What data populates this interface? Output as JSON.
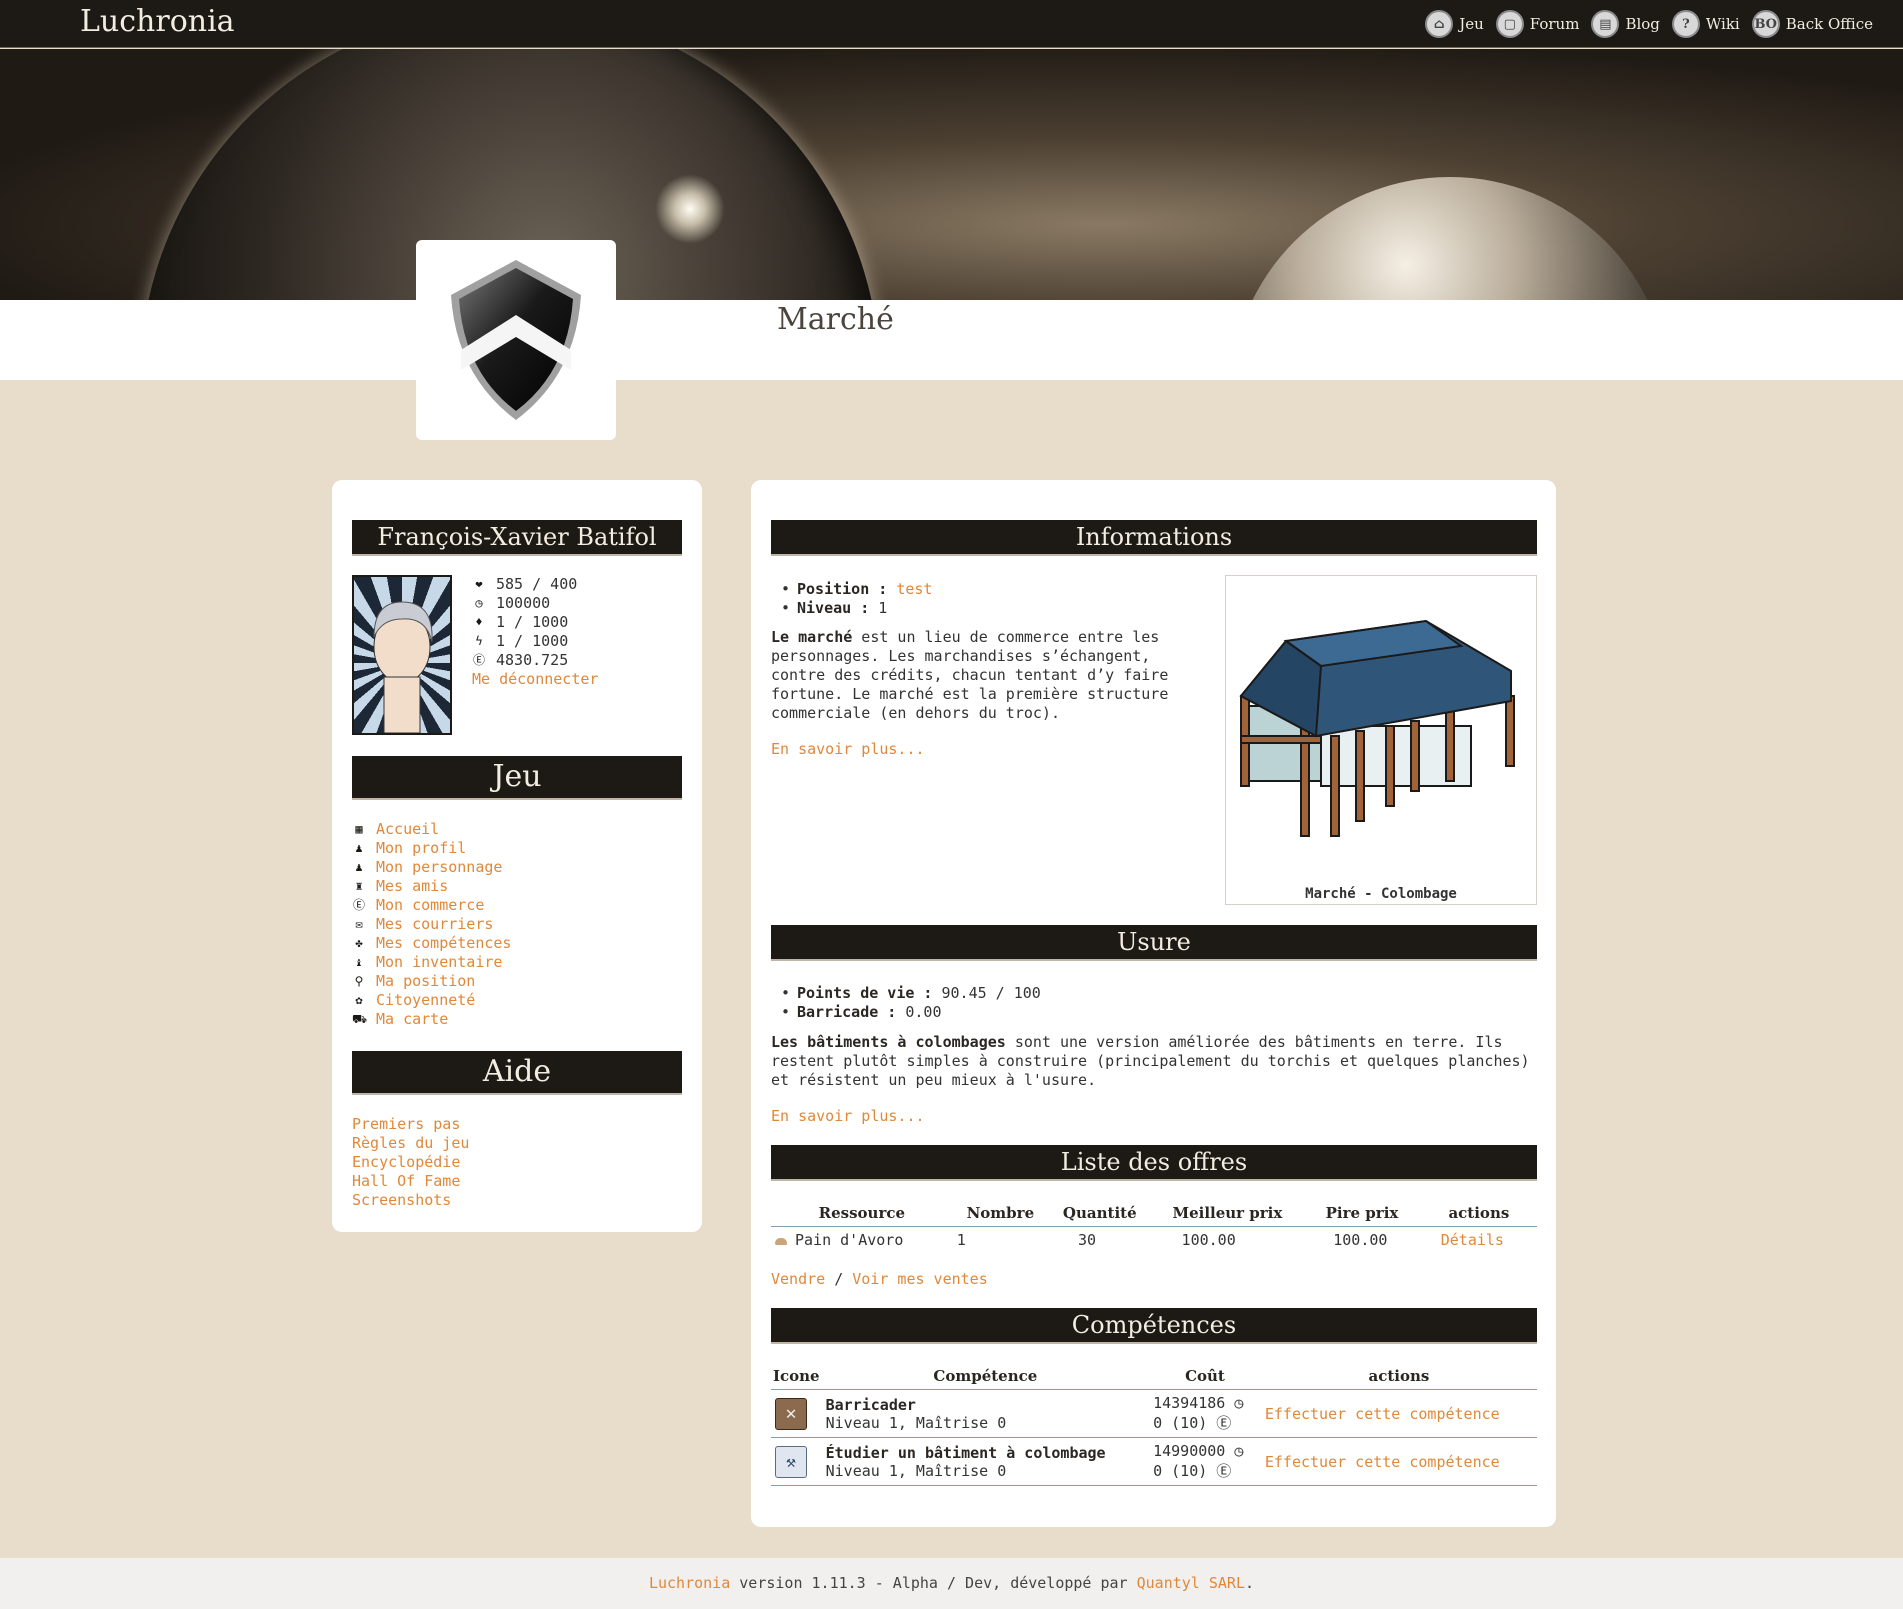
{
  "app": {
    "brand": "Luchronia"
  },
  "nav": [
    {
      "label": "Jeu",
      "icon": "home-icon",
      "glyph": "⌂"
    },
    {
      "label": "Forum",
      "icon": "forum-icon",
      "glyph": "💬"
    },
    {
      "label": "Blog",
      "icon": "blog-icon",
      "glyph": "▤"
    },
    {
      "label": "Wiki",
      "icon": "wiki-icon",
      "glyph": "?"
    },
    {
      "label": "Back Office",
      "icon": "back-office-icon",
      "glyph": "BO"
    }
  ],
  "page": {
    "title": "Marché"
  },
  "character": {
    "name": "François-Xavier Batifol",
    "stats": [
      {
        "icon": "heart-icon",
        "glyph": "❤",
        "value": "585 / 400"
      },
      {
        "icon": "clock-icon",
        "glyph": "◷",
        "value": "100000"
      },
      {
        "icon": "drop-icon",
        "glyph": "💧",
        "value": "1 / 1000"
      },
      {
        "icon": "lightning-icon",
        "glyph": "⚡",
        "value": "1 / 1000"
      },
      {
        "icon": "credits-icon",
        "glyph": "Ⓔ",
        "value": "4830.725"
      }
    ],
    "logout": "Me déconnecter"
  },
  "jeu": {
    "title": "Jeu",
    "items": [
      {
        "label": "Accueil",
        "icon": "home-icon",
        "glyph": "▦"
      },
      {
        "label": "Mon profil",
        "icon": "profile-icon",
        "glyph": "♟"
      },
      {
        "label": "Mon personnage",
        "icon": "character-icon",
        "glyph": "♟"
      },
      {
        "label": "Mes amis",
        "icon": "friends-icon",
        "glyph": "♜"
      },
      {
        "label": "Mon commerce",
        "icon": "commerce-icon",
        "glyph": "Ⓔ"
      },
      {
        "label": "Mes courriers",
        "icon": "mail-icon",
        "glyph": "✉"
      },
      {
        "label": "Mes compétences",
        "icon": "skills-icon",
        "glyph": "✤"
      },
      {
        "label": "Mon inventaire",
        "icon": "inventory-icon",
        "glyph": "♝"
      },
      {
        "label": "Ma position",
        "icon": "location-icon",
        "glyph": "⚲"
      },
      {
        "label": "Citoyenneté",
        "icon": "citizenship-icon",
        "glyph": "✿"
      },
      {
        "label": "Ma carte",
        "icon": "map-icon",
        "glyph": "⛟"
      }
    ]
  },
  "aide": {
    "title": "Aide",
    "items": [
      "Premiers pas",
      "Règles du jeu",
      "Encyclopédie",
      "Hall Of Fame",
      "Screenshots"
    ]
  },
  "informations": {
    "title": "Informations",
    "position_label": "Position",
    "position_value": "test",
    "niveau_label": "Niveau",
    "niveau_value": "1",
    "desc_bold": "Le marché",
    "desc_rest": " est un lieu de commerce entre les personnages. Les marchandises s’échangent, contre des crédits, chacun tentant d’y faire fortune. Le marché est la première structure commerciale (en dehors du troc).",
    "more": "En savoir plus...",
    "image_caption": "Marché - Colombage"
  },
  "usure": {
    "title": "Usure",
    "pv_label": "Points de vie",
    "pv_value": "90.45 / 100",
    "barricade_label": "Barricade",
    "barricade_value": "0.00",
    "desc_bold": "Les bâtiments à colombages",
    "desc_rest": " sont une version améliorée des bâtiments en terre. Ils restent plutôt simples à construire (principalement du torchis et quelques planches) et résistent un peu mieux à l'usure.",
    "more": "En savoir plus..."
  },
  "offres": {
    "title": "Liste des offres",
    "columns": [
      "Ressource",
      "Nombre",
      "Quantité",
      "Meilleur prix",
      "Pire prix",
      "actions"
    ],
    "rows": [
      {
        "resource": "Pain d'Avoro",
        "nombre": "1",
        "quantite": "30",
        "meilleur": "100.00",
        "pire": "100.00",
        "action": "Détails"
      }
    ],
    "vendre": "Vendre",
    "sep": " / ",
    "mes_ventes": "Voir mes ventes"
  },
  "competences": {
    "title": "Compétences",
    "columns": [
      "Icone",
      "Compétence",
      "Coût",
      "actions"
    ],
    "rows": [
      {
        "icon": "barricade-icon",
        "name": "Barricader",
        "sub": "Niveau 1, Maîtrise 0",
        "time": "14394186",
        "credits": "0 (10)",
        "action": "Effectuer cette compétence"
      },
      {
        "icon": "study-building-icon",
        "name": "Étudier un bâtiment à colombage",
        "sub": "Niveau 1, Maîtrise 0",
        "time": "14990000",
        "credits": "0 (10)",
        "action": "Effectuer cette compétence"
      }
    ]
  },
  "footer": {
    "brand": "Luchronia",
    "text": " version 1.11.3 - Alpha / Dev, développé par ",
    "company": "Quantyl SARL",
    "end": "."
  },
  "colors": {
    "accent": "#e0883a",
    "dark": "#1d1a16",
    "background": "#e8dccb"
  }
}
